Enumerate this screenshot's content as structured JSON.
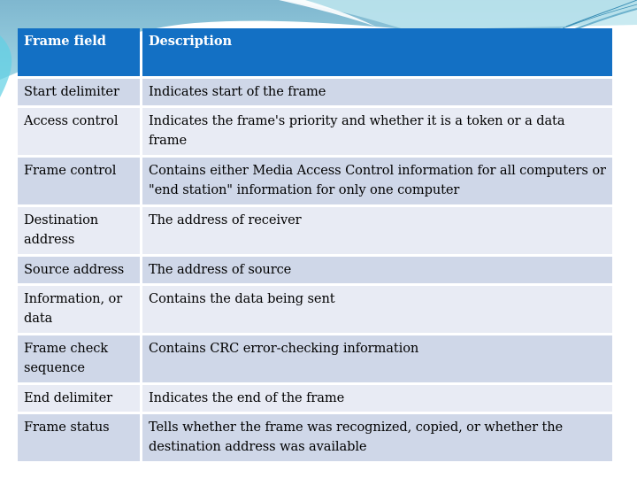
{
  "slide": {
    "colors": {
      "header_bg": "#1370c4",
      "row_odd_bg": "#cfd7e8",
      "row_even_bg": "#e8ebf4",
      "header_text": "#ffffff",
      "body_text": "#000000",
      "decor_teal": "#8cc8d8"
    }
  },
  "table": {
    "headers": [
      "Frame field",
      "Description"
    ],
    "rows": [
      {
        "field": "Start delimiter",
        "description": "Indicates start of the frame"
      },
      {
        "field": "Access control",
        "description": "Indicates the frame's priority and whether it is a token or a data frame"
      },
      {
        "field": "Frame control",
        "description": "Contains either Media Access Control information for all computers or \"end station\" information for only one computer"
      },
      {
        "field": "Destination address",
        "description": "The address of receiver"
      },
      {
        "field": "Source address",
        "description": "The address of  source"
      },
      {
        "field": "Information, or data",
        "description": "Contains the data being sent"
      },
      {
        "field": "Frame check sequence",
        "description": "Contains CRC error-checking information"
      },
      {
        "field": "End delimiter",
        "description": "Indicates the end of the frame"
      },
      {
        "field": "Frame status",
        "description": "Tells whether the frame was recognized, copied, or whether the destination address was available"
      }
    ]
  }
}
